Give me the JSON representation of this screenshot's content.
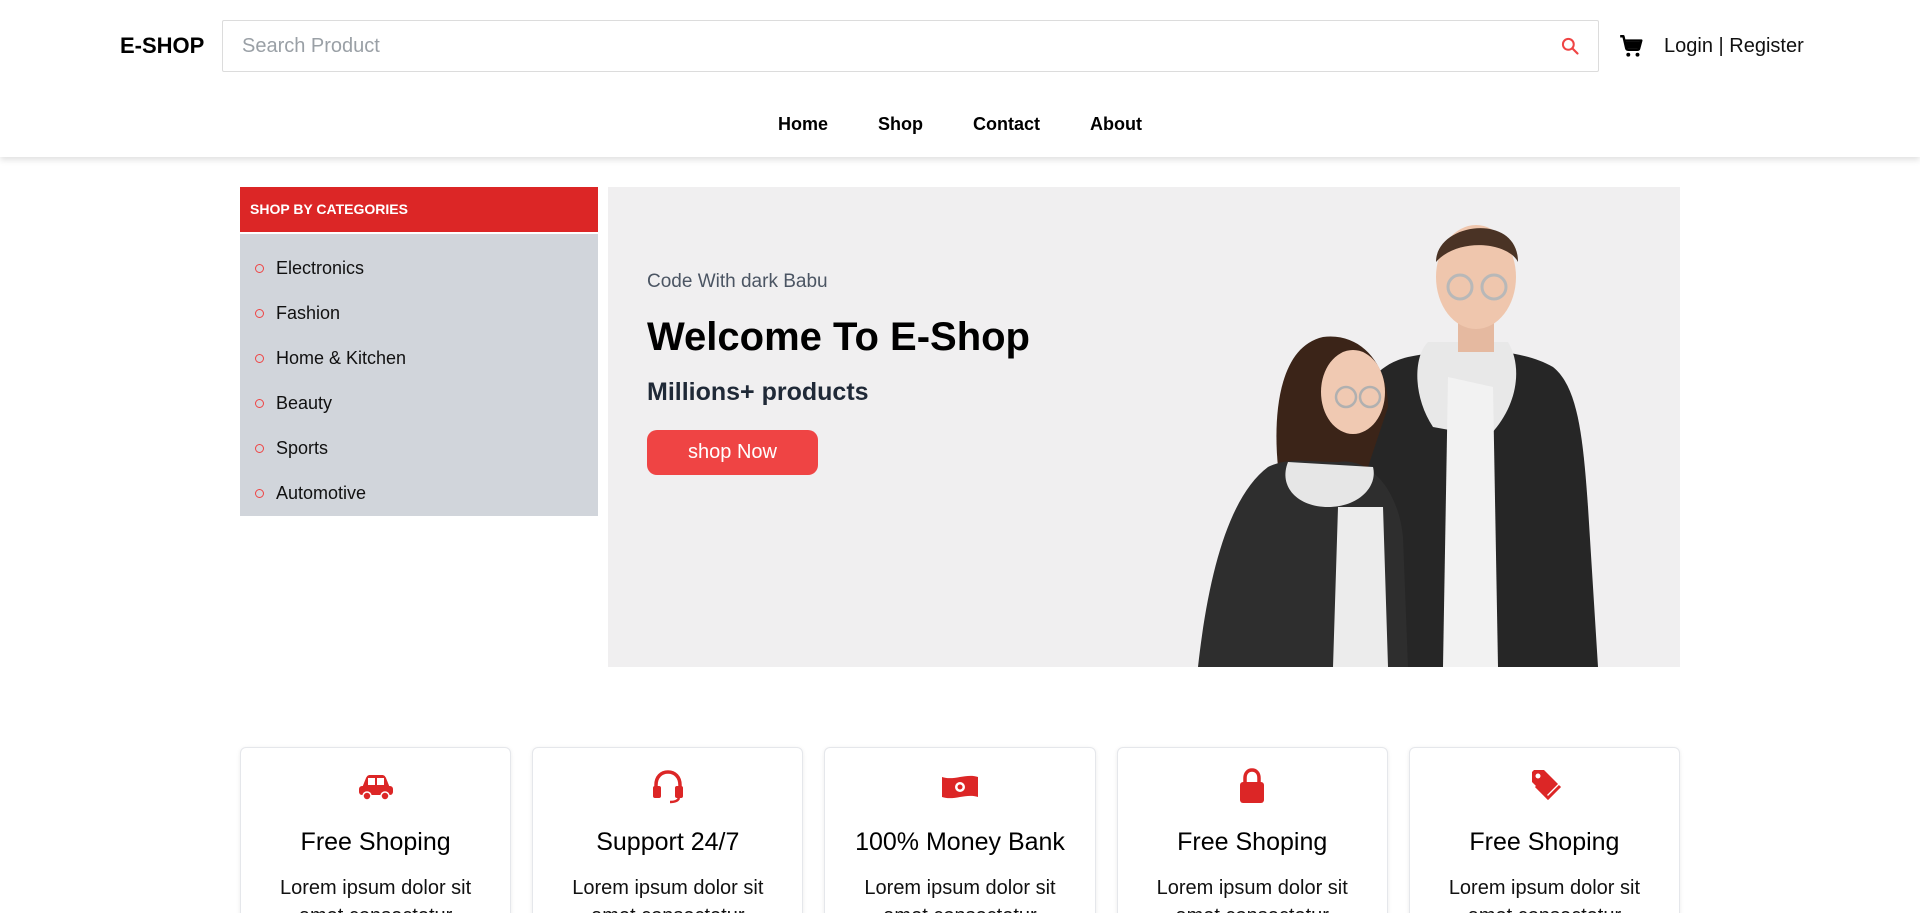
{
  "header": {
    "logo": "E-SHOP",
    "search_placeholder": "Search Product",
    "login": "Login",
    "separator": "|",
    "register": "Register",
    "icons": [
      "search-icon",
      "cart-icon"
    ]
  },
  "nav": [
    "Home",
    "Shop",
    "Contact",
    "About"
  ],
  "sidebar": {
    "title": "SHOP BY CATEGORIES",
    "items": [
      "Electronics",
      "Fashion",
      "Home & Kitchen",
      "Beauty",
      "Sports",
      "Automotive"
    ]
  },
  "hero": {
    "subtitle": "Code With dark Babu",
    "title": "Welcome To E-Shop",
    "tagline": "Millions+ products",
    "button": "shop Now"
  },
  "features": [
    {
      "icon": "car-icon",
      "title": "Free Shoping",
      "text": "Lorem ipsum dolor sit amet consectetur"
    },
    {
      "icon": "headset-icon",
      "title": "Support 24/7",
      "text": "Lorem ipsum dolor sit amet consectetur"
    },
    {
      "icon": "money-icon",
      "title": "100% Money Bank",
      "text": "Lorem ipsum dolor sit amet consectetur"
    },
    {
      "icon": "lock-icon",
      "title": "Free Shoping",
      "text": "Lorem ipsum dolor sit amet consectetur"
    },
    {
      "icon": "tag-icon",
      "title": "Free Shoping",
      "text": "Lorem ipsum dolor sit amet consectetur"
    }
  ],
  "colors": {
    "accent": "#dc2626",
    "button": "#ef4444",
    "sidebar_bg": "#d1d5db",
    "hero_bg": "#f0eff0"
  }
}
